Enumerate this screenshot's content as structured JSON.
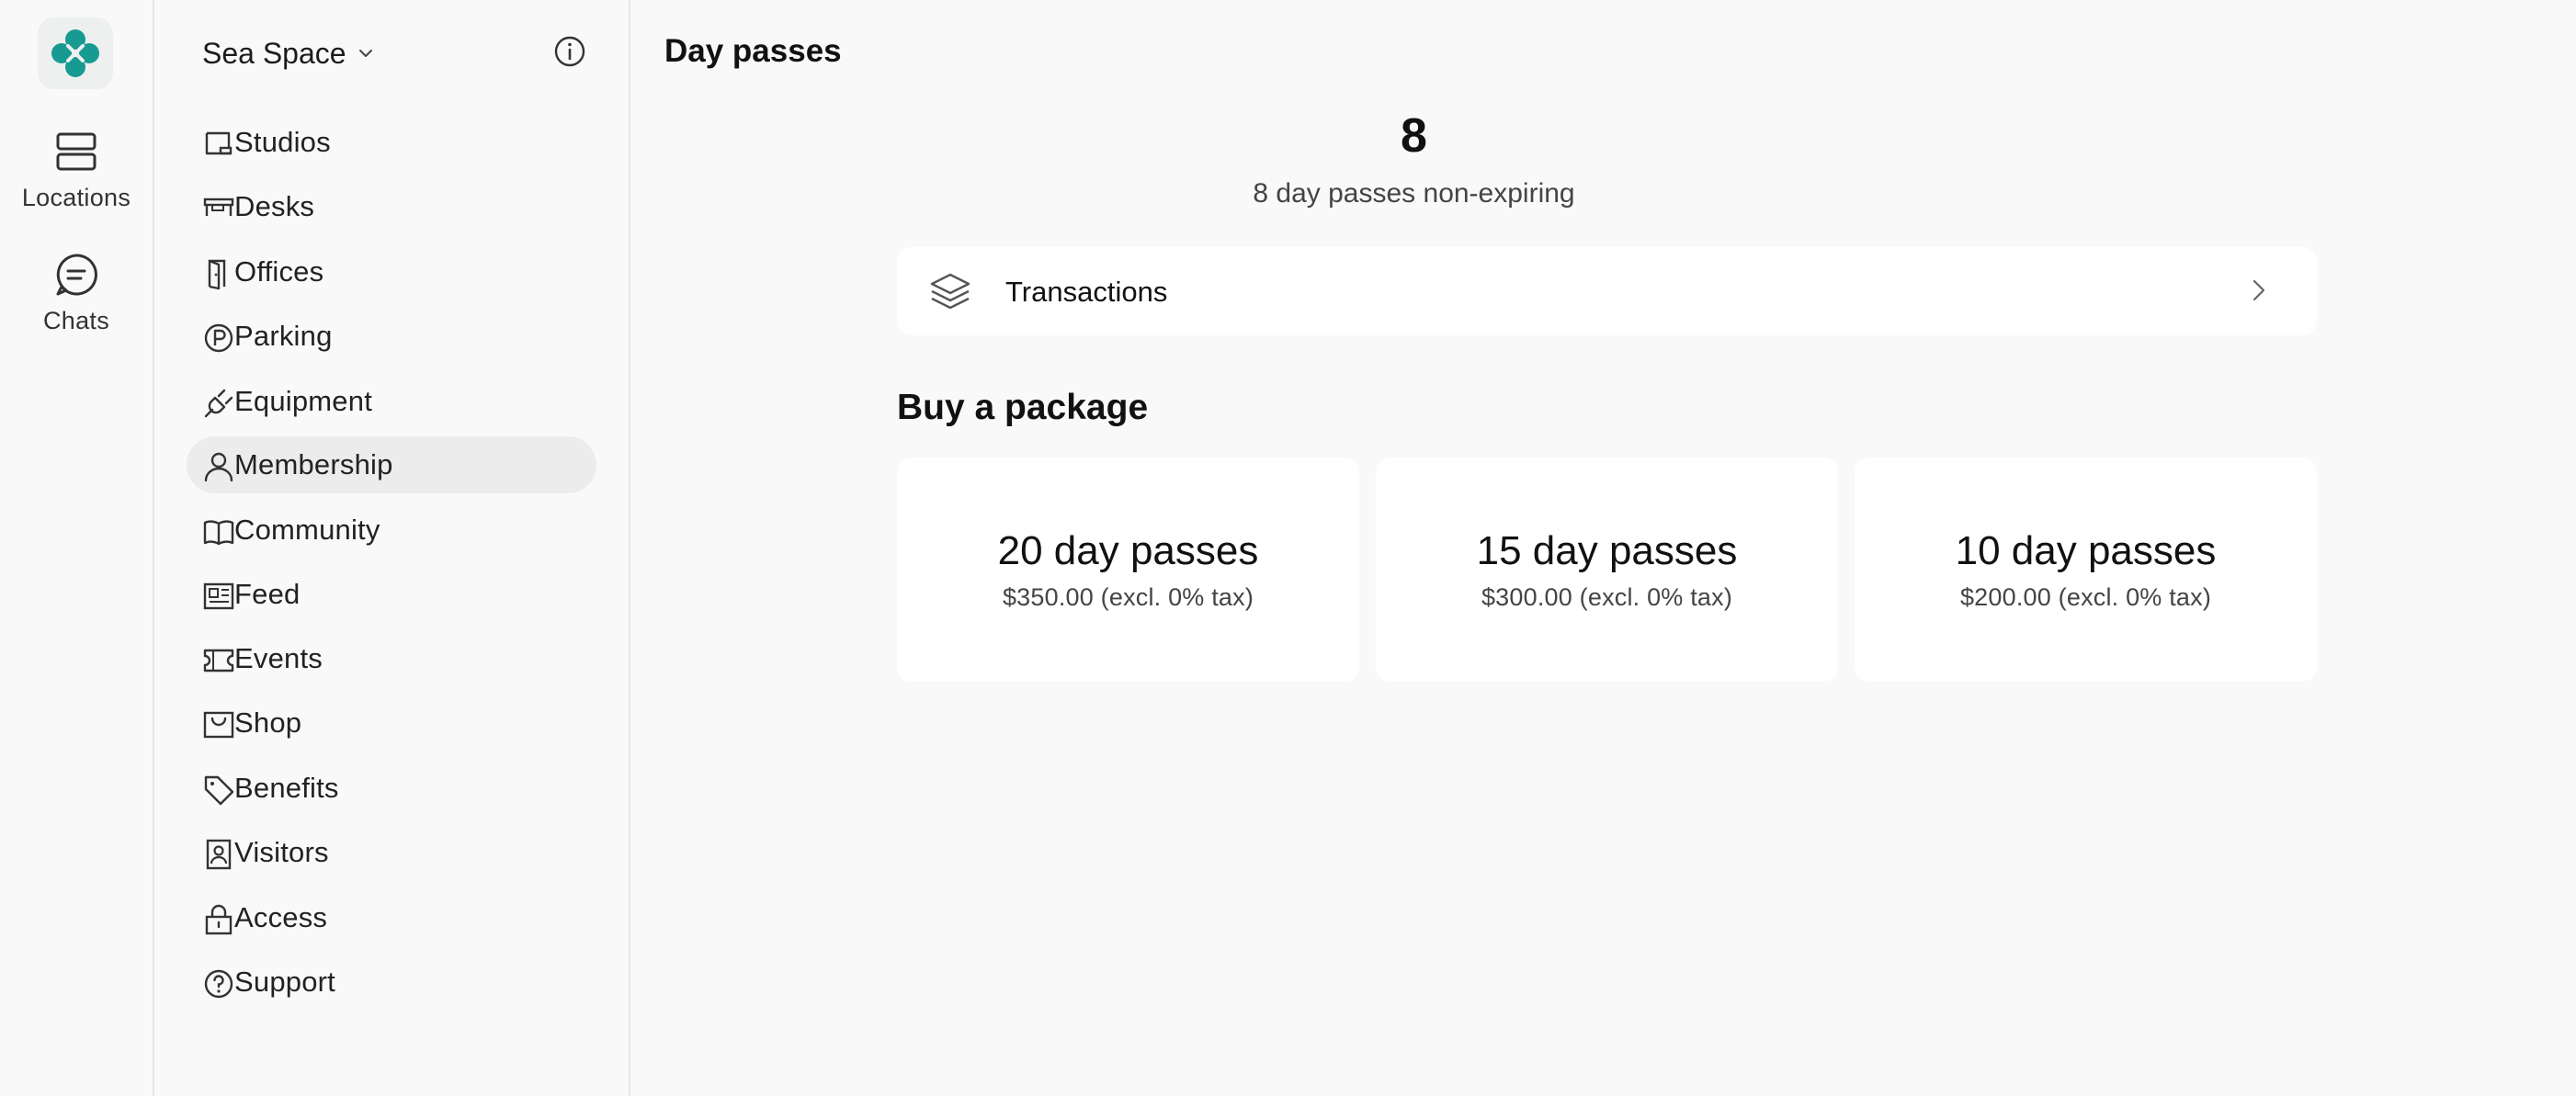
{
  "rail": {
    "items": [
      {
        "label": "Locations",
        "icon": "locations-icon"
      },
      {
        "label": "Chats",
        "icon": "chat-icon"
      }
    ],
    "brand_color": "#179a91"
  },
  "sidebar": {
    "space_name": "Sea Space",
    "items": [
      {
        "label": "Studios",
        "icon": "studio-icon"
      },
      {
        "label": "Desks",
        "icon": "desk-icon"
      },
      {
        "label": "Offices",
        "icon": "door-icon"
      },
      {
        "label": "Parking",
        "icon": "parking-icon"
      },
      {
        "label": "Equipment",
        "icon": "plug-icon"
      },
      {
        "label": "Membership",
        "icon": "person-icon",
        "active": true
      },
      {
        "label": "Community",
        "icon": "book-icon"
      },
      {
        "label": "Feed",
        "icon": "newspaper-icon"
      },
      {
        "label": "Events",
        "icon": "ticket-icon"
      },
      {
        "label": "Shop",
        "icon": "shop-icon"
      },
      {
        "label": "Benefits",
        "icon": "tag-icon"
      },
      {
        "label": "Visitors",
        "icon": "badge-icon"
      },
      {
        "label": "Access",
        "icon": "lock-icon"
      },
      {
        "label": "Support",
        "icon": "help-icon"
      }
    ]
  },
  "main": {
    "title": "Day passes",
    "balance": {
      "count": "8",
      "subtitle": "8 day passes non-expiring"
    },
    "transactions_label": "Transactions",
    "section_title": "Buy a package",
    "packages": [
      {
        "name": "20 day passes",
        "price": "$350.00 (excl. 0% tax)"
      },
      {
        "name": "15 day passes",
        "price": "$300.00 (excl. 0% tax)"
      },
      {
        "name": "10 day passes",
        "price": "$200.00 (excl. 0% tax)"
      }
    ]
  }
}
